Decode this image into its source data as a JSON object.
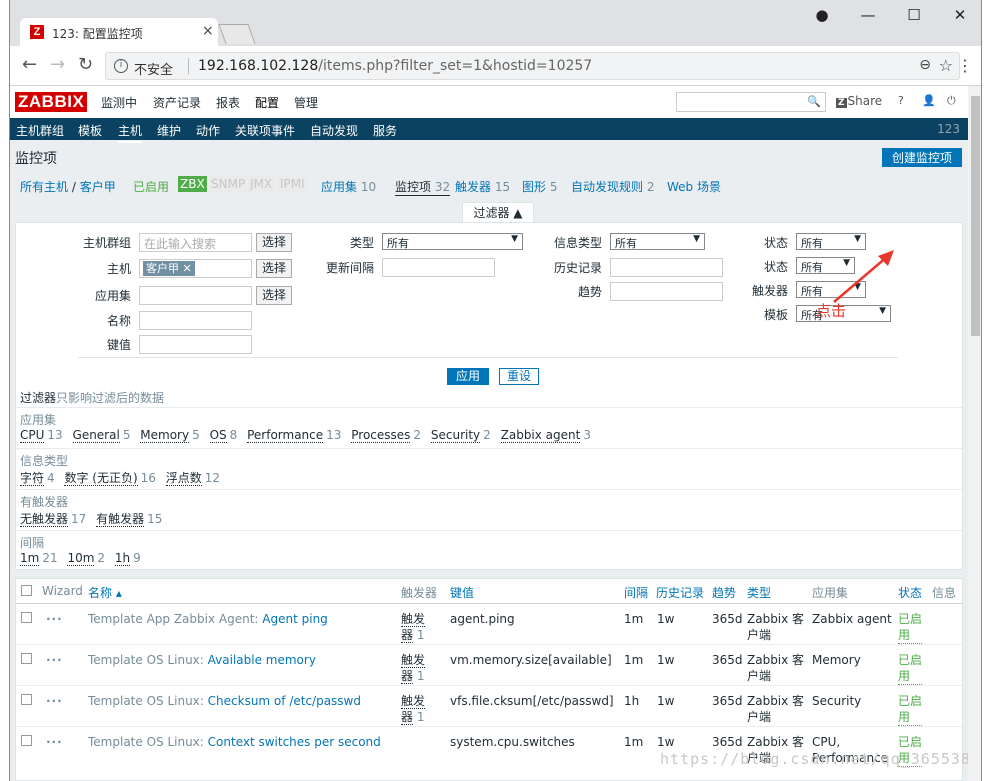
{
  "browser": {
    "tab_title": "123: 配置监控项",
    "tab_favicon": "Z",
    "security_label": "不安全",
    "url_host": "192.168.102.128",
    "url_path": "/items.php?filter_set=1&hostid=10257"
  },
  "header": {
    "logo": "ZABBIX",
    "menu": [
      "监测中",
      "资产记录",
      "报表",
      "配置",
      "管理"
    ],
    "active_menu": "配置",
    "share_label": "Share",
    "help": "?"
  },
  "submenu": {
    "items": [
      "主机群组",
      "模板",
      "主机",
      "维护",
      "动作",
      "关联项事件",
      "自动发现",
      "服务"
    ],
    "active": "主机",
    "right_text": "123"
  },
  "page": {
    "title": "监控项",
    "create_button": "创建监控项"
  },
  "hostnav": {
    "all_hosts": "所有主机",
    "sep": "/",
    "host": "客户甲",
    "status": "已启用",
    "zbx": "ZBX",
    "snmp": "SNMP",
    "jmx": "JMX",
    "ipmi": "IPMI",
    "apps": "应用集",
    "apps_count": "10",
    "items": "监控项",
    "items_count": "32",
    "triggers": "触发器",
    "triggers_count": "15",
    "graphs": "图形",
    "graphs_count": "5",
    "discovery": "自动发现规则",
    "discovery_count": "2",
    "web": "Web 场景"
  },
  "filter": {
    "tab_label": "过滤器 ▲",
    "host_group_label": "主机群组",
    "host_group_placeholder": "在此输入搜索",
    "select_label": "选择",
    "host_label": "主机",
    "host_chip": "客户甲",
    "app_label": "应用集",
    "name_label": "名称",
    "key_label": "键值",
    "type_label": "类型",
    "type_value": "所有",
    "interval_label": "更新间隔",
    "info_type_label": "信息类型",
    "info_type_value": "所有",
    "history_label": "历史记录",
    "trend_label": "趋势",
    "state_label": "状态",
    "state_value": "所有",
    "status_label": "状态",
    "status_value": "所有",
    "triggers_label": "触发器",
    "triggers_value": "所有",
    "template_label": "模板",
    "template_value": "所有",
    "apply": "应用",
    "reset": "重设",
    "note_strong": "过滤器",
    "note_dim": "只影响过滤后的数据"
  },
  "subfilter": {
    "apps_title": "应用集",
    "apps": [
      {
        "name": "CPU",
        "count": "13"
      },
      {
        "name": "General",
        "count": "5"
      },
      {
        "name": "Memory",
        "count": "5"
      },
      {
        "name": "OS",
        "count": "8"
      },
      {
        "name": "Performance",
        "count": "13"
      },
      {
        "name": "Processes",
        "count": "2"
      },
      {
        "name": "Security",
        "count": "2"
      },
      {
        "name": "Zabbix agent",
        "count": "3"
      }
    ],
    "info_title": "信息类型",
    "info": [
      {
        "name": "字符",
        "count": "4"
      },
      {
        "name": "数字 (无正负)",
        "count": "16"
      },
      {
        "name": "浮点数",
        "count": "12"
      }
    ],
    "trig_title": "有触发器",
    "trig": [
      {
        "name": "无触发器",
        "count": "17"
      },
      {
        "name": "有触发器",
        "count": "15"
      }
    ],
    "interval_title": "间隔",
    "interval": [
      {
        "name": "1m",
        "count": "21"
      },
      {
        "name": "10m",
        "count": "2"
      },
      {
        "name": "1h",
        "count": "9"
      }
    ]
  },
  "table": {
    "headers": {
      "wizard": "Wizard",
      "name": "名称 ▴",
      "triggers": "触发器",
      "key": "键值",
      "interval": "间隔",
      "history": "历史记录",
      "trends": "趋势",
      "type": "类型",
      "apps": "应用集",
      "status": "状态",
      "info": "信息"
    },
    "rows": [
      {
        "tpl": "Template App Zabbix Agent:",
        "name": "Agent ping",
        "trg1": "触发",
        "trg2": "器",
        "trgn": "1",
        "key": "agent.ping",
        "interval": "1m",
        "history": "1w",
        "trends": "365d",
        "type1": "Zabbix 客",
        "type2": "户端",
        "app1": "Zabbix agent",
        "app2": "",
        "st1": "已启",
        "st2": "用"
      },
      {
        "tpl": "Template OS Linux:",
        "name": "Available memory",
        "trg1": "触发",
        "trg2": "器",
        "trgn": "1",
        "key": "vm.memory.size[available]",
        "interval": "1m",
        "history": "1w",
        "trends": "365d",
        "type1": "Zabbix 客",
        "type2": "户端",
        "app1": "Memory",
        "app2": "",
        "st1": "已启",
        "st2": "用"
      },
      {
        "tpl": "Template OS Linux:",
        "name": "Checksum of /etc/passwd",
        "trg1": "触发",
        "trg2": "器",
        "trgn": "1",
        "key": "vfs.file.cksum[/etc/passwd]",
        "interval": "1h",
        "history": "1w",
        "trends": "365d",
        "type1": "Zabbix 客",
        "type2": "户端",
        "app1": "Security",
        "app2": "",
        "st1": "已启",
        "st2": "用"
      },
      {
        "tpl": "Template OS Linux:",
        "name": "Context switches per second",
        "trg1": "",
        "trg2": "",
        "trgn": "",
        "key": "system.cpu.switches",
        "interval": "1m",
        "history": "1w",
        "trends": "365d",
        "type1": "Zabbix 客",
        "type2": "户端",
        "app1": "CPU,",
        "app2": "Performance",
        "st1": "已启",
        "st2": "用"
      }
    ]
  },
  "annotation": "点击",
  "watermark": "https://blog.csdn.net/qq_36553835"
}
